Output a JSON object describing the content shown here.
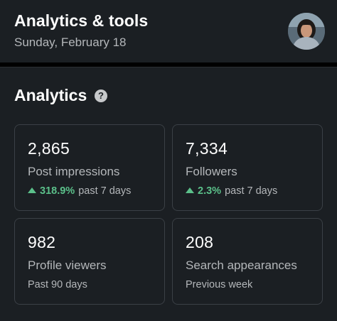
{
  "header": {
    "title": "Analytics & tools",
    "date": "Sunday, February 18"
  },
  "analytics": {
    "title": "Analytics",
    "help_icon": "question-circle-icon",
    "metrics": [
      {
        "value": "2,865",
        "label": "Post impressions",
        "trend_pct": "318.9%",
        "trend_text": "past 7 days",
        "trend_direction": "up"
      },
      {
        "value": "7,334",
        "label": "Followers",
        "trend_pct": "2.3%",
        "trend_text": "past 7 days",
        "trend_direction": "up"
      },
      {
        "value": "982",
        "label": "Profile viewers",
        "sub": "Past 90 days"
      },
      {
        "value": "208",
        "label": "Search appearances",
        "sub": "Previous week"
      }
    ]
  },
  "colors": {
    "background": "#1b1f23",
    "trend_up": "#5bc08a",
    "secondary_text": "#b4b7ba"
  }
}
